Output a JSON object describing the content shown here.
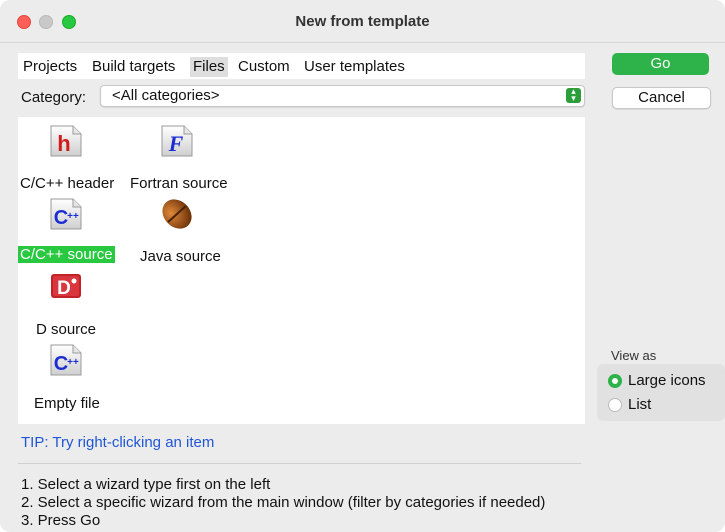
{
  "window": {
    "title": "New from template"
  },
  "tabs": [
    "Projects",
    "Build targets",
    "Files",
    "Custom",
    "User templates"
  ],
  "active_tab": "Files",
  "category": {
    "label": "Category:",
    "value": "<All categories>"
  },
  "items": [
    {
      "label": "C/C++ header",
      "icon": "c-header-icon",
      "selected": false
    },
    {
      "label": "Fortran source",
      "icon": "fortran-icon",
      "selected": false
    },
    {
      "label": "C/C++ source",
      "icon": "cpp-source-icon",
      "selected": true
    },
    {
      "label": "Java source",
      "icon": "java-bean-icon",
      "selected": false
    },
    {
      "label": "D source",
      "icon": "d-source-icon",
      "selected": false
    },
    {
      "label": "Empty file",
      "icon": "empty-file-icon",
      "selected": false
    }
  ],
  "tip": "TIP: Try right-clicking an item",
  "instructions": [
    "1. Select a wizard type first on the left",
    "2. Select a specific wizard from the main window (filter by categories if needed)",
    "3. Press Go"
  ],
  "buttons": {
    "go": "Go",
    "cancel": "Cancel"
  },
  "view_as": {
    "title": "View as",
    "options": [
      "Large icons",
      "List"
    ],
    "selected": "Large icons"
  },
  "colors": {
    "accent": "#2db34a",
    "tip": "#1f56d6",
    "selection": "#28c840"
  }
}
